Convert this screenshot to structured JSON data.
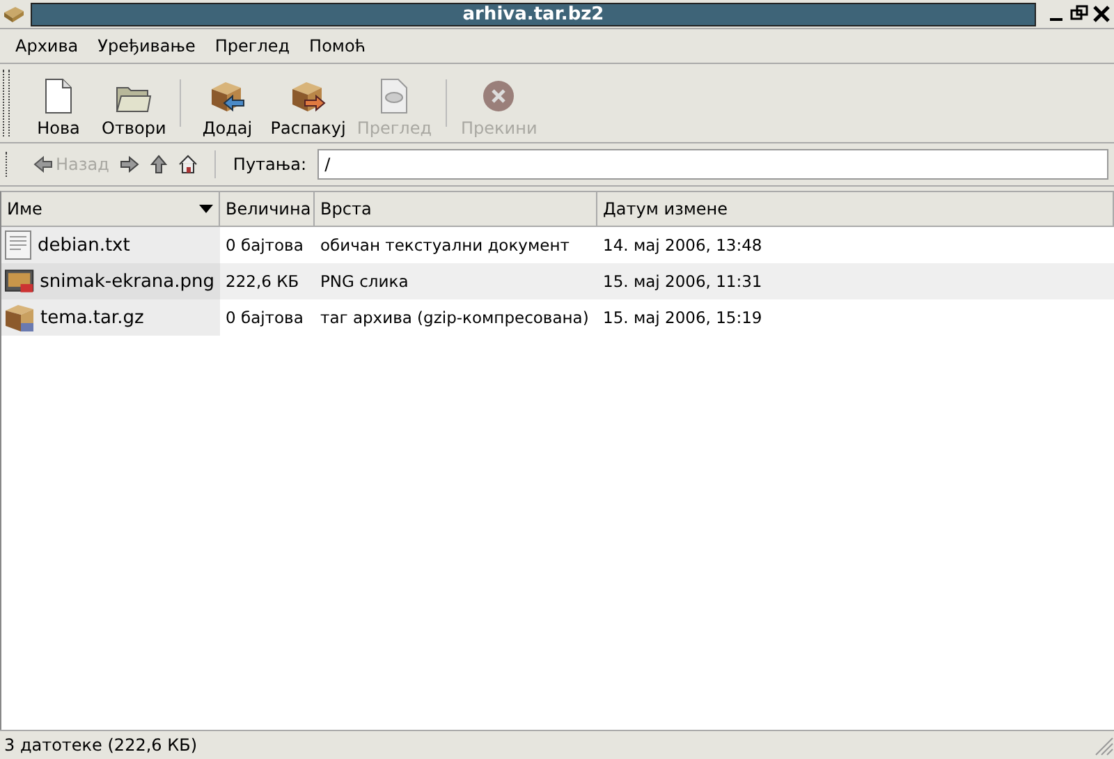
{
  "window": {
    "title": "arhiva.tar.bz2"
  },
  "menu": [
    "Архива",
    "Уређивање",
    "Преглед",
    "Помоћ"
  ],
  "toolbar": [
    {
      "label": "Нова",
      "kind": "new",
      "disabled": false
    },
    {
      "label": "Отвори",
      "kind": "open",
      "disabled": false
    },
    {
      "label": "Додај",
      "kind": "add",
      "disabled": false
    },
    {
      "label": "Распакуј",
      "kind": "extract",
      "disabled": false
    },
    {
      "label": "Преглед",
      "kind": "view",
      "disabled": true
    },
    {
      "label": "Прекини",
      "kind": "stop",
      "disabled": true
    }
  ],
  "location": {
    "back": {
      "label": "Назад",
      "disabled": true
    },
    "path_label": "Путања:",
    "path": "/"
  },
  "table": {
    "columns": [
      "Име",
      "Величина",
      "Врста",
      "Датум измене"
    ],
    "rows": [
      {
        "kind": "text",
        "name": "debian.txt",
        "size": "0 бајтова",
        "type": "обичан текстуални документ",
        "date": "14. мај 2006, 13:48"
      },
      {
        "kind": "image",
        "name": "snimak-ekrana.png",
        "size": "222,6 КБ",
        "type": "PNG слика",
        "date": "15. мај 2006, 11:31"
      },
      {
        "kind": "archive",
        "name": "tema.tar.gz",
        "size": "0 бајтова",
        "type": "таг архива (gzip-компресована)",
        "date": "15. мај 2006, 15:19"
      }
    ]
  },
  "status_bar": "3 датотеке (222,6 КБ)"
}
